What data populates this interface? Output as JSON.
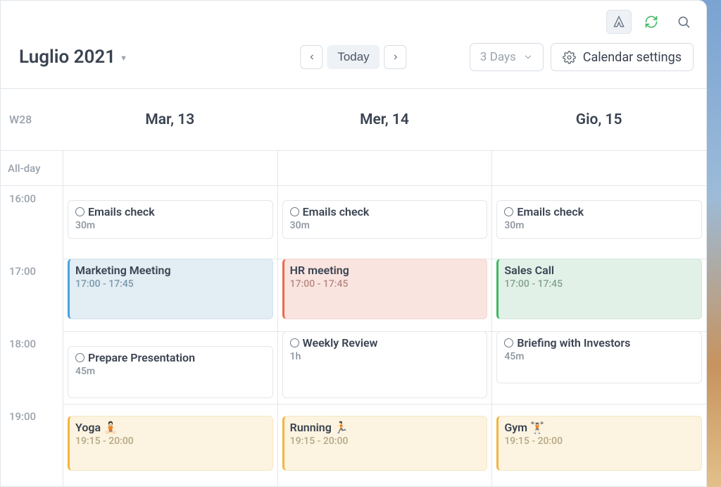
{
  "toolbar": {
    "logo_tooltip": "App",
    "refresh_tooltip": "Refresh",
    "search_tooltip": "Search"
  },
  "header": {
    "title": "Luglio 2021",
    "today_label": "Today",
    "range_label": "3 Days",
    "settings_label": "Calendar settings"
  },
  "week": {
    "label": "W28",
    "allday_label": "All-day"
  },
  "days": [
    {
      "label": "Mar,  13"
    },
    {
      "label": "Mer,  14"
    },
    {
      "label": "Gio,  15"
    }
  ],
  "hours": [
    "16:00",
    "17:00",
    "18:00",
    "19:00"
  ],
  "events": {
    "d0": {
      "e0": {
        "title": "Emails check",
        "sub": "30m"
      },
      "e1": {
        "title": "Marketing Meeting",
        "sub": "17:00 - 17:45"
      },
      "e2": {
        "title": "Prepare Presentation",
        "sub": "45m"
      },
      "e3": {
        "title": "Yoga 🧘🏻",
        "sub": "19:15 - 20:00"
      }
    },
    "d1": {
      "e0": {
        "title": "Emails check",
        "sub": "30m"
      },
      "e1": {
        "title": "HR meeting",
        "sub": "17:00 - 17:45"
      },
      "e2": {
        "title": "Weekly Review",
        "sub": "1h"
      },
      "e3": {
        "title": "Running 🏃🏻",
        "sub": "19:15 - 20:00"
      }
    },
    "d2": {
      "e0": {
        "title": "Emails check",
        "sub": "30m"
      },
      "e1": {
        "title": "Sales Call",
        "sub": "17:00 - 17:45"
      },
      "e2": {
        "title": "Briefing with Investors",
        "sub": "45m"
      },
      "e3": {
        "title": "Gym 🏋🏻",
        "sub": "19:15 - 20:00"
      }
    }
  }
}
